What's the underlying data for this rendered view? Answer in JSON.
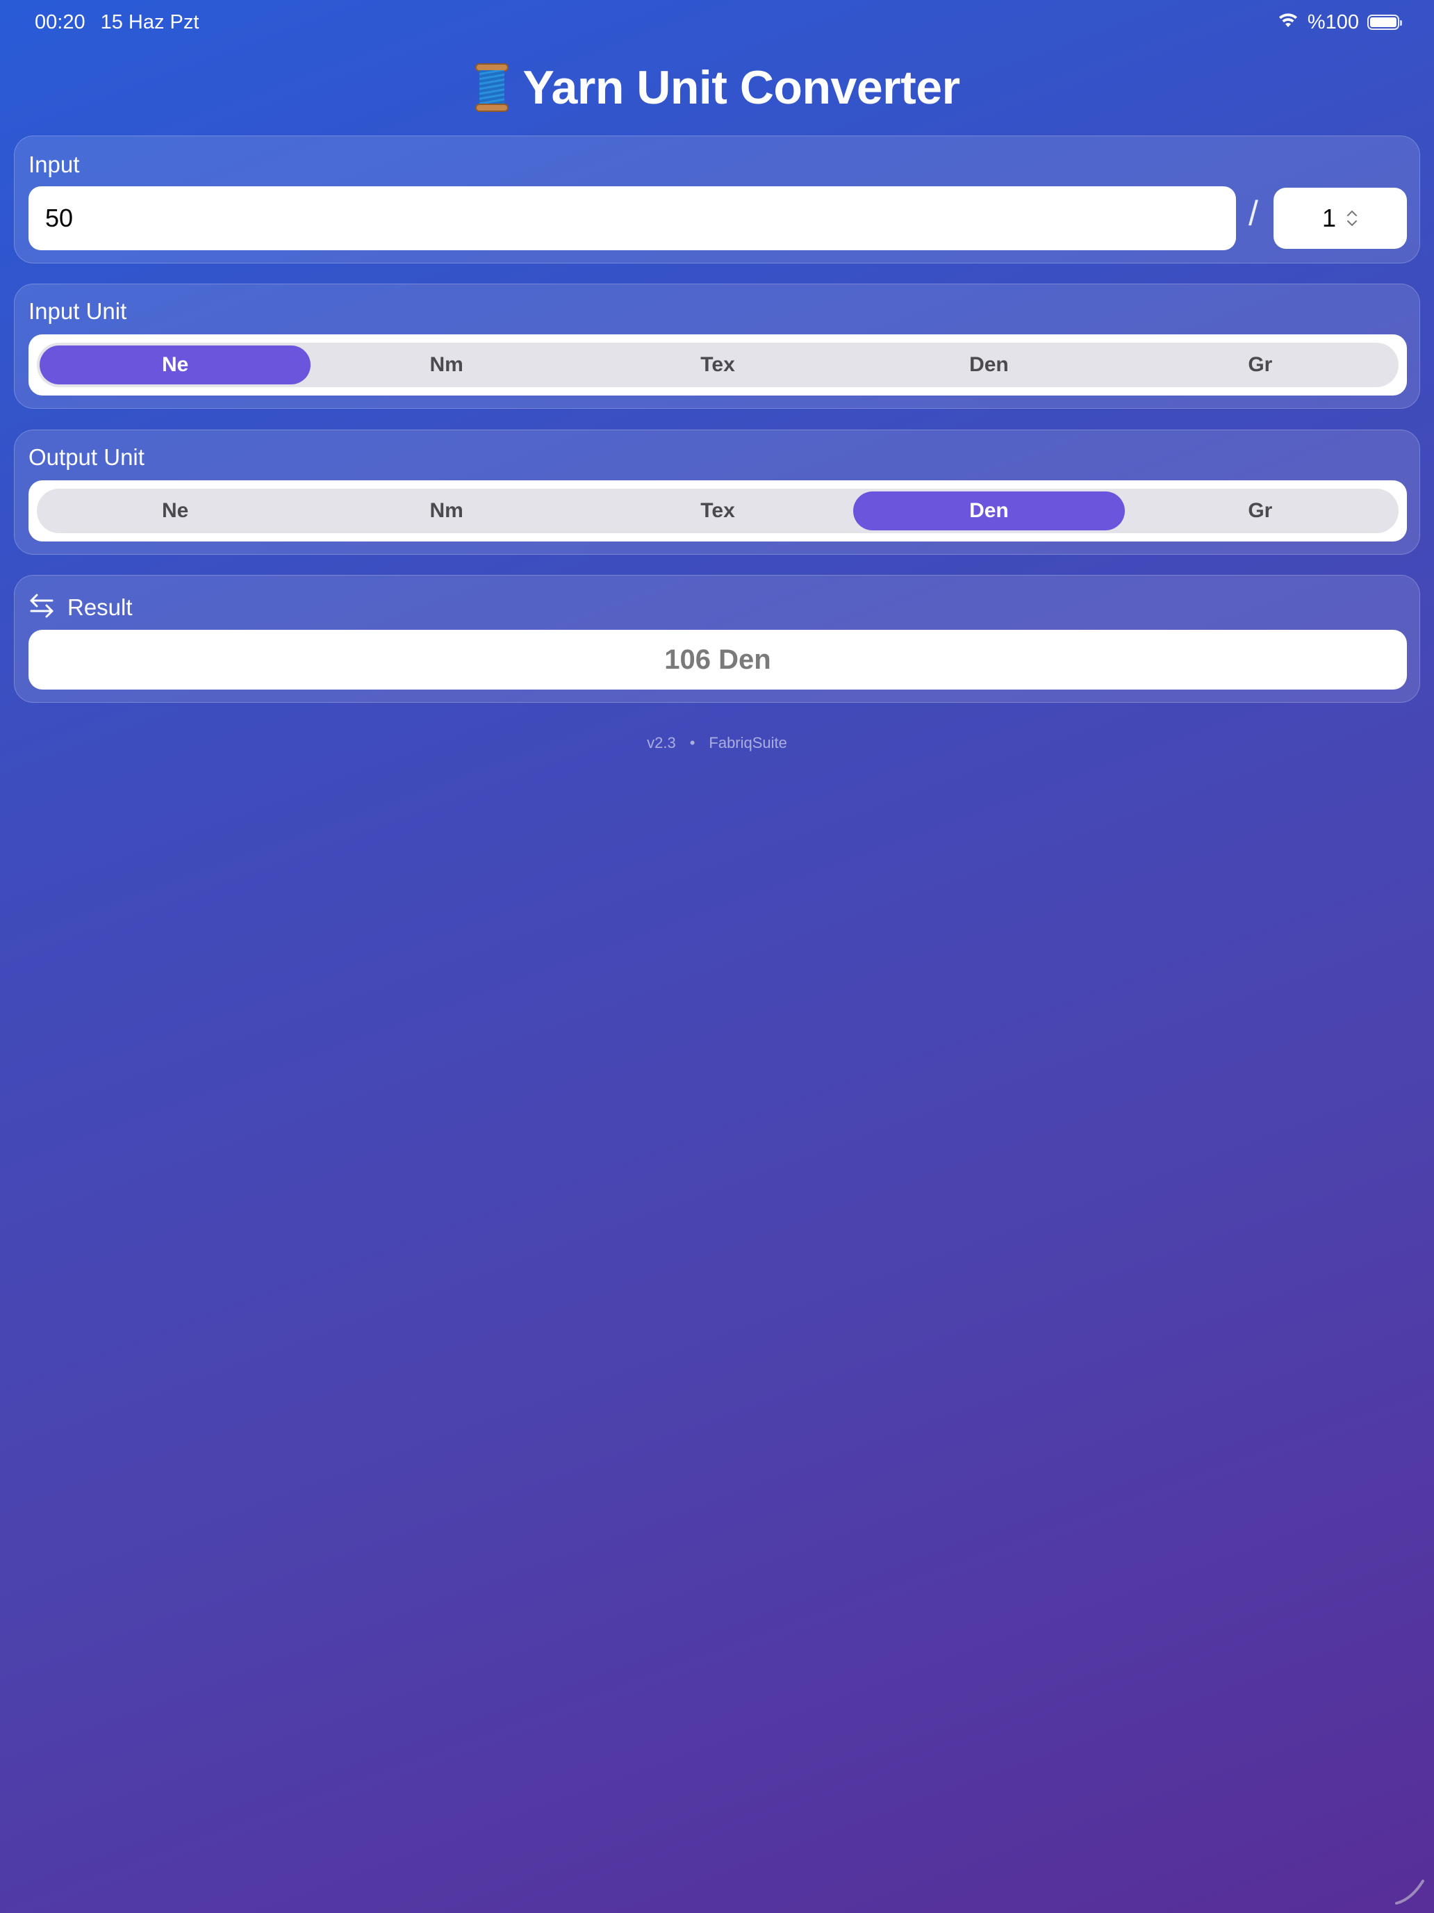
{
  "status_bar": {
    "time": "00:20",
    "date": "15 Haz Pzt",
    "battery": "%100",
    "wifi_icon": "wifi-icon",
    "battery_icon": "battery-icon"
  },
  "header": {
    "title": "Yarn Unit Converter",
    "icon": "spool-of-thread-icon"
  },
  "input": {
    "label": "Input",
    "value": "50",
    "separator": "/",
    "divisor": "1"
  },
  "input_unit": {
    "label": "Input Unit",
    "options": [
      "Ne",
      "Nm",
      "Tex",
      "Den",
      "Gr"
    ],
    "selected": "Ne"
  },
  "output_unit": {
    "label": "Output Unit",
    "options": [
      "Ne",
      "Nm",
      "Tex",
      "Den",
      "Gr"
    ],
    "selected": "Den"
  },
  "result": {
    "label": "Result",
    "icon": "swap-arrows-icon",
    "value": "106 Den"
  },
  "footer": {
    "version": "v2.3",
    "dot": "•",
    "brand": "FabriqSuite"
  },
  "colors": {
    "accent": "#6b55dc",
    "background_start": "#2a5bd7",
    "background_end": "#582e98"
  }
}
